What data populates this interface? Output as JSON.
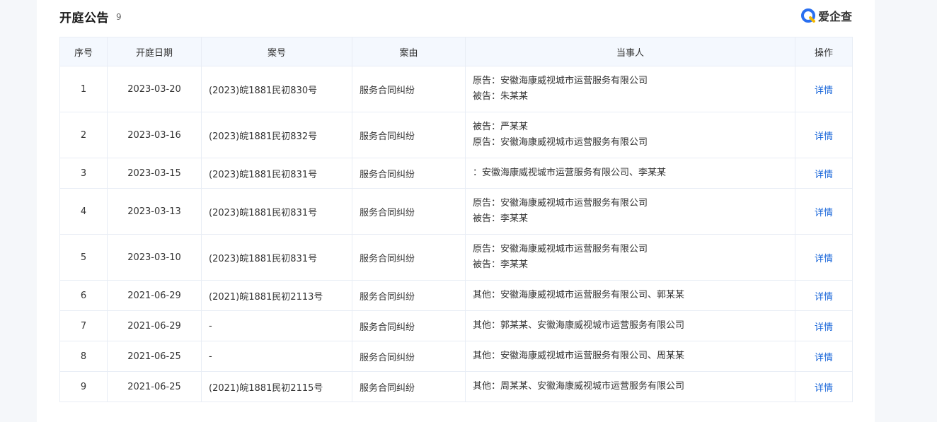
{
  "header": {
    "title": "开庭公告",
    "count": "9",
    "brand": "爱企查",
    "brand_icon": "aiqicha-logo-icon"
  },
  "table": {
    "columns": [
      "序号",
      "开庭日期",
      "案号",
      "案由",
      "当事人",
      "操作"
    ],
    "rows": [
      {
        "no": "1",
        "date": "2023-03-20",
        "case_no": "(2023)皖1881民初830号",
        "cause": "服务合同纠纷",
        "parties": [
          "原告：安徽海康威视城市运营服务有限公司",
          "被告：朱某某"
        ],
        "action": "详情"
      },
      {
        "no": "2",
        "date": "2023-03-16",
        "case_no": "(2023)皖1881民初832号",
        "cause": "服务合同纠纷",
        "parties": [
          "被告：严某某",
          "原告：安徽海康威视城市运营服务有限公司"
        ],
        "action": "详情"
      },
      {
        "no": "3",
        "date": "2023-03-15",
        "case_no": "(2023)皖1881民初831号",
        "cause": "服务合同纠纷",
        "parties": [
          "：安徽海康威视城市运营服务有限公司、李某某"
        ],
        "action": "详情"
      },
      {
        "no": "4",
        "date": "2023-03-13",
        "case_no": "(2023)皖1881民初831号",
        "cause": "服务合同纠纷",
        "parties": [
          "原告：安徽海康威视城市运营服务有限公司",
          "被告：李某某"
        ],
        "action": "详情"
      },
      {
        "no": "5",
        "date": "2023-03-10",
        "case_no": "(2023)皖1881民初831号",
        "cause": "服务合同纠纷",
        "parties": [
          "原告：安徽海康威视城市运营服务有限公司",
          "被告：李某某"
        ],
        "action": "详情"
      },
      {
        "no": "6",
        "date": "2021-06-29",
        "case_no": "(2021)皖1881民初2113号",
        "cause": "服务合同纠纷",
        "parties": [
          "其他：安徽海康威视城市运营服务有限公司、郭某某"
        ],
        "action": "详情"
      },
      {
        "no": "7",
        "date": "2021-06-29",
        "case_no": "-",
        "cause": "服务合同纠纷",
        "parties": [
          "其他：郭某某、安徽海康威视城市运营服务有限公司"
        ],
        "action": "详情"
      },
      {
        "no": "8",
        "date": "2021-06-25",
        "case_no": "-",
        "cause": "服务合同纠纷",
        "parties": [
          "其他：安徽海康威视城市运营服务有限公司、周某某"
        ],
        "action": "详情"
      },
      {
        "no": "9",
        "date": "2021-06-25",
        "case_no": "(2021)皖1881民初2115号",
        "cause": "服务合同纠纷",
        "parties": [
          "其他：周某某、安徽海康威视城市运营服务有限公司"
        ],
        "action": "详情"
      }
    ]
  },
  "colors": {
    "link": "#1664d9",
    "header_bg": "#f4f8fe",
    "border": "#e8edf5",
    "brand_blue": "#2a6ff0",
    "brand_yellow": "#f5b800"
  }
}
